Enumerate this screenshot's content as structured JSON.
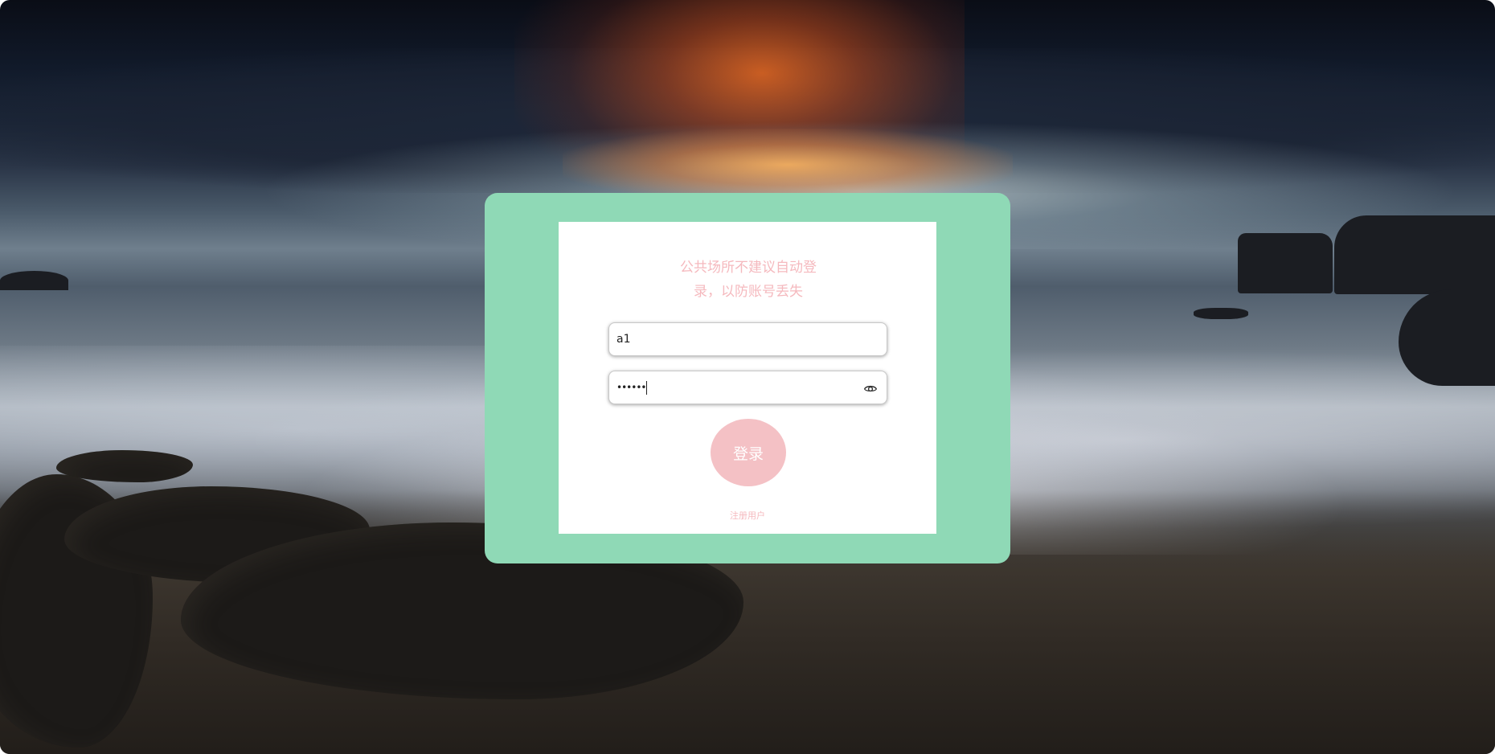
{
  "login": {
    "notice_line1": "公共场所不建议自动登",
    "notice_line2": "录，以防账号丢失",
    "username_value": "a1",
    "password_value": "••••••",
    "login_button": "登录",
    "register_link": "注册用户"
  },
  "icons": {
    "password_toggle": "eye-icon"
  },
  "colors": {
    "card_background": "#8fd9b6",
    "panel_background": "#ffffff",
    "accent_pink": "#f4c1c5",
    "text_pink": "#f5b9be"
  }
}
